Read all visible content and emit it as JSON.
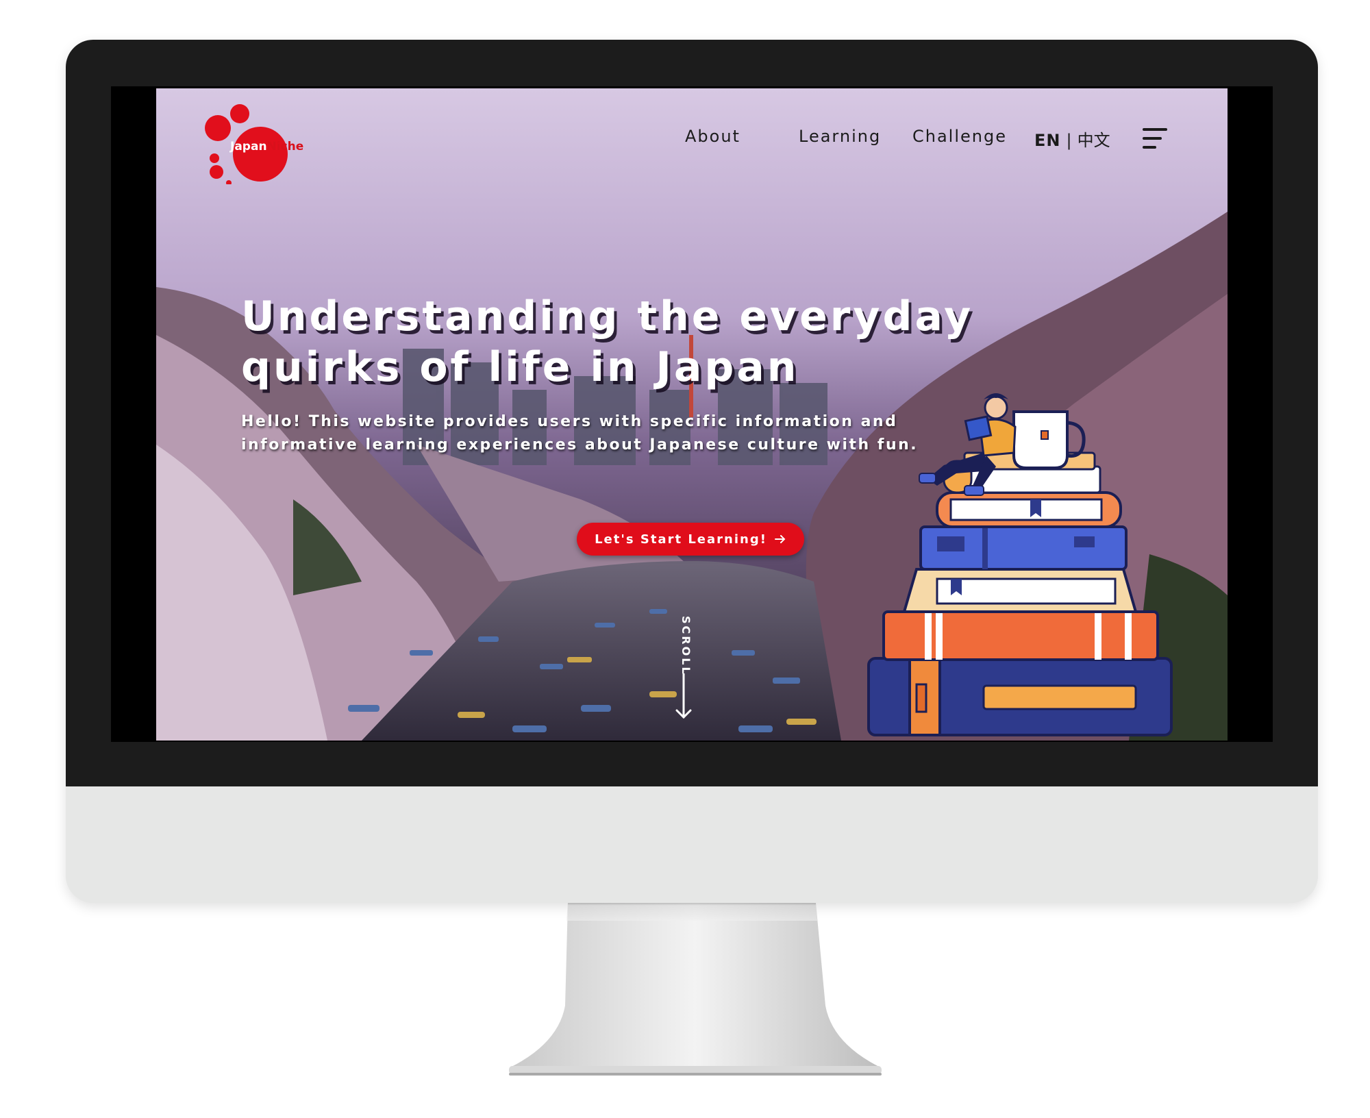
{
  "brand": {
    "name_part1": "Japan",
    "name_part2": "Niche",
    "logo_icon": "red-dots-circle-logo",
    "color": "#d9101b"
  },
  "nav": {
    "items": [
      {
        "label": "About"
      },
      {
        "label": "Learning"
      },
      {
        "label": "Challenge"
      }
    ]
  },
  "language": {
    "current": "EN",
    "separator": "|",
    "alternate": "中文"
  },
  "menu": {
    "icon": "hamburger-menu-icon"
  },
  "hero": {
    "headline_line1": "Understanding the everyday",
    "headline_line2": "quirks of life in Japan",
    "subtitle_line1": "Hello! This website provides users with specific information and",
    "subtitle_line2": "informative learning experiences about Japanese culture with fun.",
    "cta_label": "Let's Start Learning!",
    "cta_icon": "arrow-right-icon",
    "cta_color": "#e00d1a",
    "scroll_label": "SCROLL",
    "scroll_icon": "arrow-down-icon",
    "illustration": "person-reading-on-book-stack-illustration"
  }
}
